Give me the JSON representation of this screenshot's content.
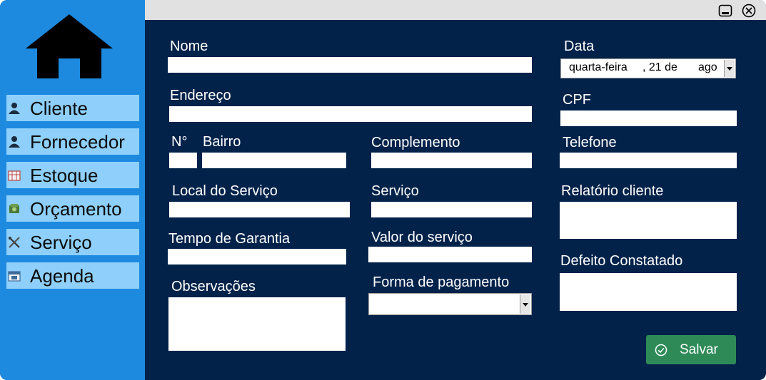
{
  "window": {
    "minimize_icon": "minimize-icon",
    "close_icon": "close-icon"
  },
  "sidebar": {
    "home_icon": "home-icon",
    "items": [
      {
        "label": "Cliente",
        "icon": "user-icon"
      },
      {
        "label": "Fornecedor",
        "icon": "user-icon"
      },
      {
        "label": "Estoque",
        "icon": "inventory-icon"
      },
      {
        "label": "Orçamento",
        "icon": "money-icon"
      },
      {
        "label": "Serviço",
        "icon": "tools-icon"
      },
      {
        "label": "Agenda",
        "icon": "calendar-icon"
      }
    ]
  },
  "form": {
    "nome": {
      "label": "Nome",
      "value": ""
    },
    "endereco": {
      "label": "Endereço",
      "value": ""
    },
    "numero": {
      "label": "N°",
      "value": ""
    },
    "bairro": {
      "label": "Bairro",
      "value": ""
    },
    "complemento": {
      "label": "Complemento",
      "value": ""
    },
    "local_servico": {
      "label": "Local do Serviço",
      "value": ""
    },
    "servico": {
      "label": "Serviço",
      "value": ""
    },
    "tempo_garantia": {
      "label": "Tempo de Garantia",
      "value": ""
    },
    "valor_servico": {
      "label": "Valor do serviço",
      "value": ""
    },
    "observacoes": {
      "label": "Observações",
      "value": ""
    },
    "forma_pagamento": {
      "label": "Forma de pagamento",
      "value": ""
    },
    "data": {
      "label": "Data",
      "weekday": "quarta-feira",
      "day": ", 21 de",
      "month": "ago"
    },
    "cpf": {
      "label": "CPF",
      "value": ""
    },
    "telefone": {
      "label": "Telefone",
      "value": ""
    },
    "relatorio_cliente": {
      "label": "Relatório cliente",
      "value": ""
    },
    "defeito_constatado": {
      "label": "Defeito Constatado",
      "value": ""
    }
  },
  "save_button": {
    "label": "Salvar",
    "icon": "check-circle-icon"
  },
  "colors": {
    "sidebar_bg": "#1d8ae0",
    "nav_item_bg": "#8ed0fb",
    "main_bg": "#02224a",
    "titlebar_bg": "#e1e1e1",
    "save_bg": "#2e8b57"
  }
}
